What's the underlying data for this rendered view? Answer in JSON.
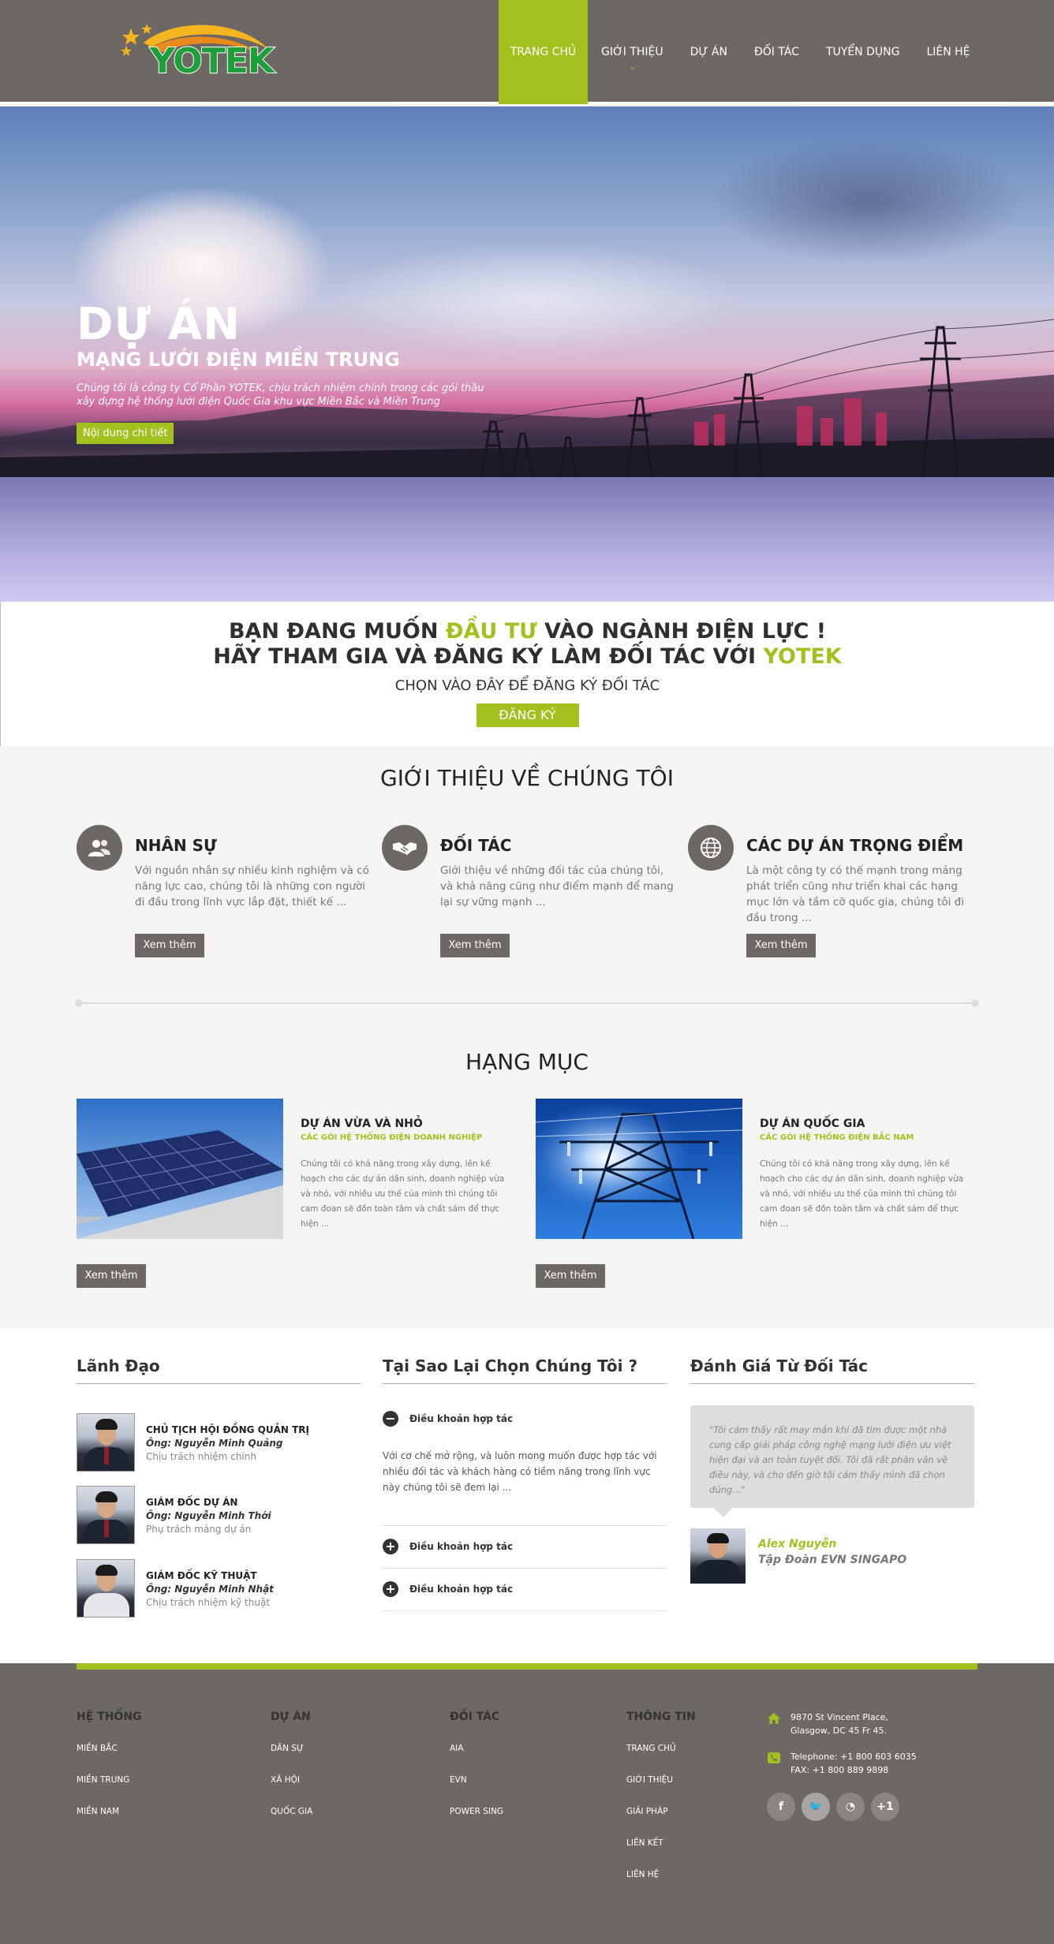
{
  "brand": {
    "logo_text": "YOTEK",
    "accent": "#a2c11f",
    "header_bg": "#6d6863"
  },
  "nav": [
    {
      "label": "TRANG CHỦ",
      "active": true
    },
    {
      "label": "GIỚI THIỆU",
      "has_dropdown": true
    },
    {
      "label": "DỰ ÁN"
    },
    {
      "label": "ĐỐI TÁC"
    },
    {
      "label": "TUYỂN DỤNG"
    },
    {
      "label": "LIÊN HỆ"
    }
  ],
  "hero": {
    "title": "DỰ ÁN",
    "subtitle": "MẠNG LƯỚI ĐIỆN MIỀN TRUNG",
    "desc_line1": "Chúng tôi là công ty Cổ Phần YOTEK, chịu trách nhiệm chính trong các gói thầu",
    "desc_line2": "xây dựng hệ thống lưới điện Quốc Gia khu vực Miền Bắc và Miền Trung",
    "button": "Nội dung chi tiết"
  },
  "cta": {
    "line1_a": "BẠN ĐANG MUỐN ",
    "line1_b": "ĐẦU TƯ",
    "line1_c": " VÀO NGÀNH ĐIỆN LỰC !",
    "line2_a": "HÃY THAM GIA VÀ ĐĂNG KÝ LÀM ĐỐI TÁC VỚI ",
    "line2_b": "YOTEK",
    "sub": "CHỌN VÀO ĐÂY ĐỂ ĐĂNG KÝ ĐỐI TÁC",
    "button": "ĐĂNG KÝ"
  },
  "about": {
    "title": "GIỚI THIỆU VỀ CHÚNG TÔI",
    "features": [
      {
        "icon": "people-icon",
        "title": "NHÂN SỰ",
        "desc": "Với nguồn nhân sự nhiều kinh nghiệm và có năng lực cao, chúng tôi là những con người đi đầu trong lĩnh vực lắp đặt, thiết kế ...",
        "button": "Xem thêm"
      },
      {
        "icon": "handshake-icon",
        "title": "ĐỐI TÁC",
        "desc": "Giới thiệu về những đối tác của chúng tôi, và khả năng cũng như điểm mạnh để mang lại sự vững mạnh ...",
        "button": "Xem thêm"
      },
      {
        "icon": "globe-icon",
        "title": "CÁC DỰ ÁN TRỌNG ĐIỂM",
        "desc": "Là một công ty có thế mạnh trong mảng phát triển cũng như triển khai các hạng mục lớn và tầm cỡ quốc gia, chúng tôi đi đầu trong ...",
        "button": "Xem thêm"
      }
    ]
  },
  "categories": {
    "title": "HẠNG MỤC",
    "items": [
      {
        "name": "DỰ ÁN VỪA VÀ NHỎ",
        "tag": "CÁC GÓI HỆ THỐNG ĐIỆN DOANH NGHIỆP",
        "desc": "Chúng tôi có khả năng trong xây dựng, lên kế hoạch cho các dự án dân sinh, doanh nghiệp vừa và nhỏ, với nhiều ưu thế của mình thì chúng tôi cam đoan sẽ đồn toàn tâm và chất sám để thực hiện ...",
        "button": "Xem thêm"
      },
      {
        "name": "DỰ ÁN QUỐC GIA",
        "tag": "CÁC GÓI HỆ THỐNG ĐIỆN BẮC NAM",
        "desc": "Chúng tôi có khả năng trong xây dựng, lên kế hoạch cho các dự án dân sinh, doanh nghiệp vừa và nhỏ, với nhiều ưu thế của mình thì chúng tôi cam đoan sẽ đồn toàn tâm và chất sám để thực hiện ...",
        "button": "Xem thêm"
      }
    ]
  },
  "leaders": {
    "title": "Lãnh Đạo",
    "items": [
      {
        "role": "CHỦ TỊCH HỘI ĐỒNG QUẢN TRỊ",
        "name": "Ông: Nguyễn Minh Quảng",
        "duty": "Chịu trách nhiệm chính"
      },
      {
        "role": "GIÁM ĐỐC DỰ ÁN",
        "name": "Ông: Nguyễn Minh Thới",
        "duty": "Phụ trách mảng dự án"
      },
      {
        "role": "GIÁM ĐỐC KỸ THUẬT",
        "name": "Ông: Nguyễn Minh Nhật",
        "duty": "Chịu trách nhiệm kỹ thuật"
      }
    ]
  },
  "why": {
    "title": "Tại Sao Lại Chọn Chúng Tôi  ?",
    "items": [
      {
        "sign": "−",
        "label": "Điều khoản hợp tác",
        "body": "Với cơ chế mở rộng, và luôn mong muốn được hợp tác với nhiều đối tác và khách hàng có tiềm năng trong lĩnh vực này chúng tôi sẽ đem lại ..."
      },
      {
        "sign": "+",
        "label": "Điều khoản hợp tác"
      },
      {
        "sign": "+",
        "label": "Điều khoản hợp tác"
      }
    ]
  },
  "review": {
    "title": "Đánh Giá Từ Đối Tác",
    "quote": "\"Tôi cảm thấy rất may mắn khi đã tìm được một nhà cung cấp giải pháp công nghệ mạng lưới điện ưu việt hiện đại và an toàn tuyệt đối. Tôi đã rất phân vân về điều này, và cho đến giờ tôi cảm thấy mình đã chọn đúng...\"",
    "name": "Alex Nguyễn",
    "org": "Tập Đoàn EVN SINGAPO"
  },
  "footer": {
    "cols": [
      {
        "title": "HỆ THỐNG",
        "items": [
          "MIỀN BẮC",
          "MIỀN TRUNG",
          "MIỀN NAM"
        ]
      },
      {
        "title": "DỰ ÁN",
        "items": [
          "DÂN SỰ",
          "XÃ HỘI",
          "QUỐC GIA"
        ]
      },
      {
        "title": "ĐỐI TÁC",
        "items": [
          "AIA",
          "EVN",
          "POWER SING"
        ]
      },
      {
        "title": "THÔNG TIN",
        "items": [
          "TRANG CHỦ",
          "GIỚI THIỆU",
          "GIẢI PHÁP",
          "LIÊN KẾT",
          "LIÊN HỆ"
        ]
      }
    ],
    "address_1": "9870 St Vincent Place,",
    "address_2": "Glasgow, DC 45 Fr 45.",
    "phone": "Telephone: +1 800 603 6035",
    "fax": "FAX: +1 800 889 9898",
    "socials": [
      {
        "icon": "facebook-icon",
        "glyph": "f"
      },
      {
        "icon": "twitter-icon",
        "glyph": "🐦"
      },
      {
        "icon": "rss-icon",
        "glyph": "◔"
      },
      {
        "icon": "google-plus-icon",
        "glyph": "+1"
      }
    ]
  }
}
